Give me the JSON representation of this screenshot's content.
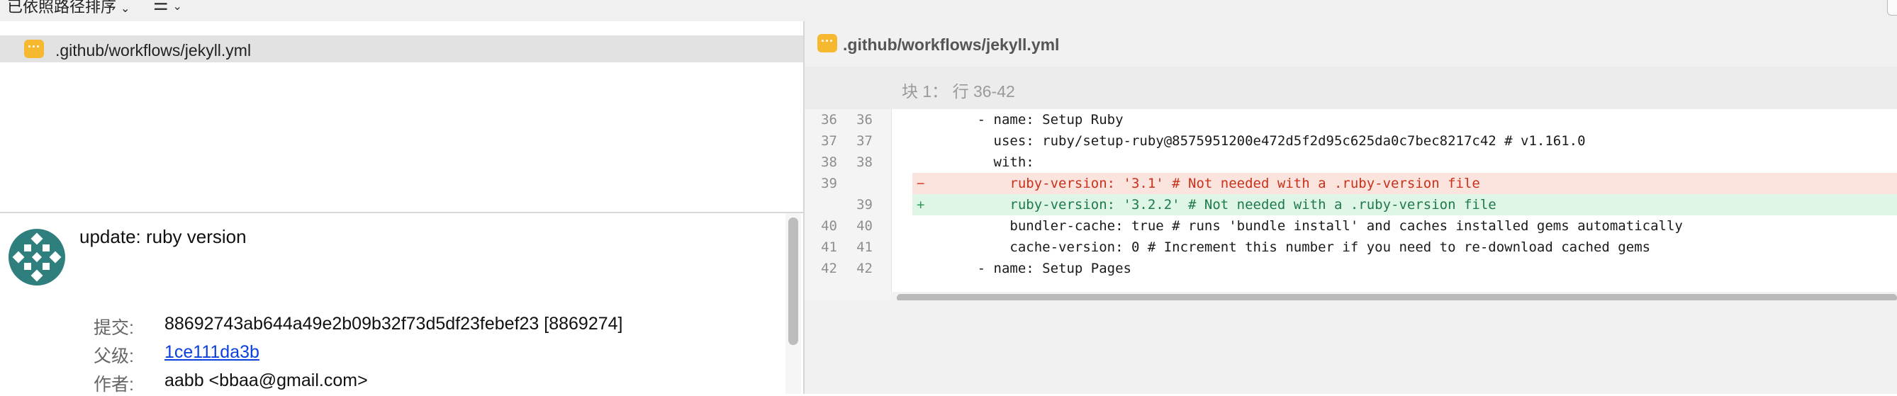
{
  "toolbar": {
    "sort_label": "已依照路径排序",
    "sort_chevron": "⌄",
    "view_icon": "list-icon",
    "view_glyph": "☰",
    "view_chevron": "⌄"
  },
  "files": [
    {
      "badge": "···",
      "name": ".github/workflows/jekyll.yml"
    }
  ],
  "commit": {
    "message": "update: ruby version",
    "avatar_color": "#2f7f7e",
    "fields": [
      {
        "label": "提交:",
        "value": "88692743ab644a49e2b09b32f73d5df23febef23 [8869274]"
      },
      {
        "label": "父级:",
        "value": "1ce111da3b"
      },
      {
        "label": "作者:",
        "value": "aabb <bbaa@gmail.com>"
      }
    ]
  },
  "diff": {
    "file": ".github/workflows/jekyll.yml",
    "hunk_label": "块 1： 行 36-42",
    "lines": [
      {
        "type": "ctx",
        "old": "36",
        "new": "36",
        "sign": "",
        "text": "      - name: Setup Ruby"
      },
      {
        "type": "ctx",
        "old": "37",
        "new": "37",
        "sign": "",
        "text": "        uses: ruby/setup-ruby@8575951200e472d5f2d95c625da0c7bec8217c42 # v1.161.0"
      },
      {
        "type": "ctx",
        "old": "38",
        "new": "38",
        "sign": "",
        "text": "        with:"
      },
      {
        "type": "del",
        "old": "39",
        "new": "",
        "sign": "−",
        "text": "          ruby-version: '3.1' # Not needed with a .ruby-version file"
      },
      {
        "type": "add",
        "old": "",
        "new": "39",
        "sign": "+",
        "text": "          ruby-version: '3.2.2' # Not needed with a .ruby-version file"
      },
      {
        "type": "ctx",
        "old": "40",
        "new": "40",
        "sign": "",
        "text": "          bundler-cache: true # runs 'bundle install' and caches installed gems automatically"
      },
      {
        "type": "ctx",
        "old": "41",
        "new": "41",
        "sign": "",
        "text": "          cache-version: 0 # Increment this number if you need to re-download cached gems"
      },
      {
        "type": "ctx",
        "old": "42",
        "new": "42",
        "sign": "",
        "text": "      - name: Setup Pages"
      }
    ]
  },
  "colors": {
    "badge": "#f5b82e",
    "deleted_bg": "#fbe3de",
    "added_bg": "#dff5e6",
    "link": "#0b3fe0"
  }
}
